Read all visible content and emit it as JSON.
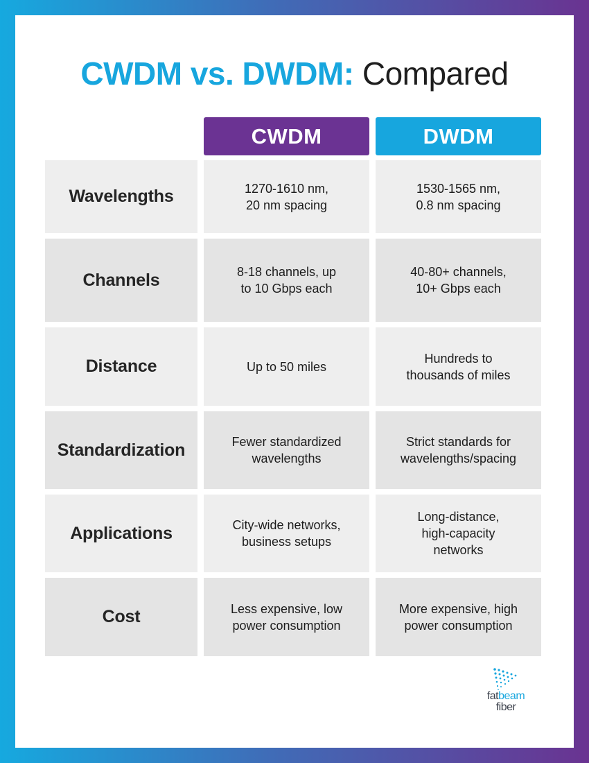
{
  "title": {
    "accent": "CWDM vs. DWDM:",
    "rest": " Compared"
  },
  "colors": {
    "cwdm_header": "#6b3393",
    "dwdm_header": "#17a6de",
    "title_accent": "#17a6de",
    "row_shade_light": "#eeeeee",
    "row_shade_dark": "#e4e4e4"
  },
  "columns": [
    "CWDM",
    "DWDM"
  ],
  "rows": [
    {
      "label": "Wavelengths",
      "cwdm": [
        "1270-1610 nm,",
        "20 nm spacing"
      ],
      "dwdm": [
        "1530-1565 nm,",
        "0.8 nm spacing"
      ]
    },
    {
      "label": "Channels",
      "cwdm": [
        "8-18 channels, up",
        "to 10 Gbps each"
      ],
      "dwdm": [
        "40-80+ channels,",
        "10+ Gbps each"
      ]
    },
    {
      "label": "Distance",
      "cwdm": [
        "Up to 50 miles"
      ],
      "dwdm": [
        "Hundreds to",
        "thousands of miles"
      ]
    },
    {
      "label": "Standardization",
      "cwdm": [
        "Fewer standardized",
        "wavelengths"
      ],
      "dwdm": [
        "Strict standards for",
        "wavelengths/spacing"
      ]
    },
    {
      "label": "Applications",
      "cwdm": [
        "City-wide networks,",
        "business setups"
      ],
      "dwdm": [
        "Long-distance,",
        "high-capacity",
        "networks"
      ]
    },
    {
      "label": "Cost",
      "cwdm": [
        "Less expensive, low",
        "power consumption"
      ],
      "dwdm": [
        "More expensive, high",
        "power consumption"
      ]
    }
  ],
  "logo": {
    "icon": "dotted-beam-icon",
    "word1a": "fat",
    "word1b": "beam",
    "word2": "fiber"
  }
}
